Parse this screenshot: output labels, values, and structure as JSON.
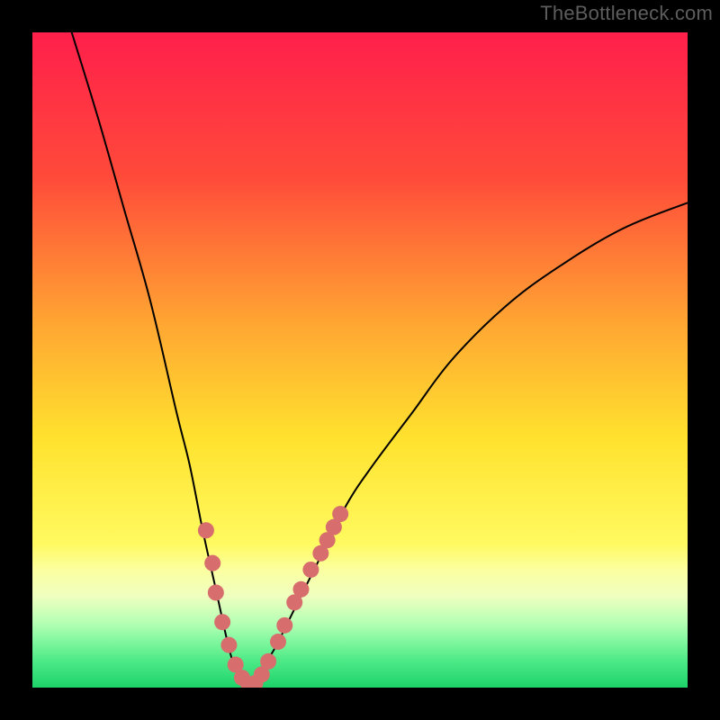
{
  "watermark": "TheBottleneck.com",
  "chart_data": {
    "type": "line",
    "title": "",
    "xlabel": "",
    "ylabel": "",
    "xlim": [
      0,
      100
    ],
    "ylim": [
      0,
      100
    ],
    "series": [
      {
        "name": "bottleneck-curve",
        "x": [
          6,
          10,
          14,
          18,
          22,
          24,
          26,
          28,
          30,
          31,
          32,
          33,
          34,
          35,
          37,
          40,
          44,
          48,
          52,
          58,
          64,
          72,
          80,
          90,
          100
        ],
        "y": [
          100,
          87,
          73,
          59,
          42,
          34,
          24,
          15,
          6,
          3,
          1,
          0.5,
          1,
          3,
          6,
          12,
          20,
          28,
          34,
          42,
          50,
          58,
          64,
          70,
          74
        ]
      }
    ],
    "markers": {
      "name": "highlighted-points",
      "color": "#d86d6d",
      "points": [
        {
          "x": 26.5,
          "y": 24
        },
        {
          "x": 27.5,
          "y": 19
        },
        {
          "x": 28.0,
          "y": 14.5
        },
        {
          "x": 29.0,
          "y": 10
        },
        {
          "x": 30.0,
          "y": 6.5
        },
        {
          "x": 31.0,
          "y": 3.5
        },
        {
          "x": 32.0,
          "y": 1.5
        },
        {
          "x": 33.0,
          "y": 0.5
        },
        {
          "x": 34.0,
          "y": 0.7
        },
        {
          "x": 35.0,
          "y": 2
        },
        {
          "x": 36.0,
          "y": 4
        },
        {
          "x": 37.5,
          "y": 7
        },
        {
          "x": 38.5,
          "y": 9.5
        },
        {
          "x": 40.0,
          "y": 13
        },
        {
          "x": 41.0,
          "y": 15
        },
        {
          "x": 42.5,
          "y": 18
        },
        {
          "x": 44.0,
          "y": 20.5
        },
        {
          "x": 45.0,
          "y": 22.5
        },
        {
          "x": 46.0,
          "y": 24.5
        },
        {
          "x": 47.0,
          "y": 26.5
        }
      ]
    },
    "gradient_stops": [
      {
        "offset": 0,
        "color": "#ff1f4b"
      },
      {
        "offset": 22,
        "color": "#ff4a3a"
      },
      {
        "offset": 45,
        "color": "#ffa832"
      },
      {
        "offset": 62,
        "color": "#ffe22e"
      },
      {
        "offset": 78,
        "color": "#fffa60"
      },
      {
        "offset": 82,
        "color": "#fbffa0"
      },
      {
        "offset": 86,
        "color": "#f0ffc0"
      },
      {
        "offset": 90,
        "color": "#b7ffb4"
      },
      {
        "offset": 93,
        "color": "#80f79f"
      },
      {
        "offset": 96,
        "color": "#4ce986"
      },
      {
        "offset": 100,
        "color": "#1dd36a"
      }
    ]
  }
}
